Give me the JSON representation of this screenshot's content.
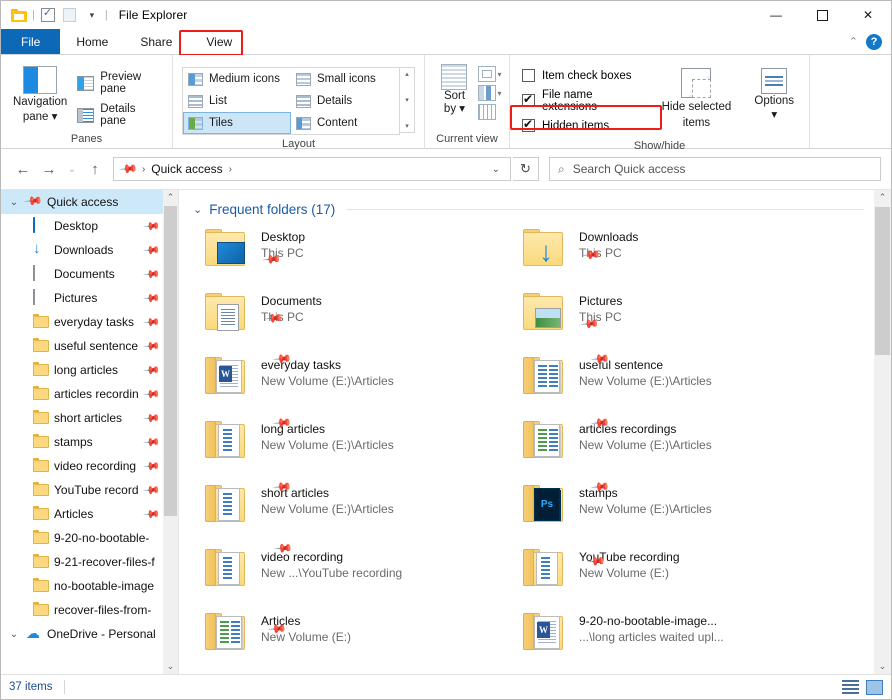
{
  "window": {
    "title": "File Explorer",
    "quick_access_toolbar": [
      {
        "name": "folder-icon",
        "label": ""
      },
      {
        "name": "properties-icon",
        "label": ""
      },
      {
        "name": "new-folder-icon",
        "label": ""
      },
      {
        "name": "customize-caret-icon",
        "label": "⌄"
      }
    ],
    "controls": {
      "minimize": "—",
      "maximize": "☐",
      "close": "✕"
    },
    "ribbon_collapse": "⌃",
    "help": "?"
  },
  "tabs": [
    {
      "label": "File",
      "active": false,
      "style": "file"
    },
    {
      "label": "Home",
      "active": false,
      "style": "normal"
    },
    {
      "label": "Share",
      "active": false,
      "style": "normal"
    },
    {
      "label": "View",
      "active": true,
      "style": "normal",
      "highlighted": true
    }
  ],
  "ribbon": {
    "groups": [
      {
        "name": "panes",
        "label": "Panes",
        "big_button": {
          "label_line1": "Navigation",
          "label_line2": "pane ▾"
        },
        "small_buttons": [
          {
            "label": "Preview pane",
            "icon": "preview-pane-icon"
          },
          {
            "label": "Details pane",
            "icon": "details-pane-icon"
          }
        ]
      },
      {
        "name": "layout",
        "label": "Layout",
        "items": [
          {
            "label": "Medium icons",
            "selected": false
          },
          {
            "label": "Small icons",
            "selected": false
          },
          {
            "label": "List",
            "selected": false
          },
          {
            "label": "Details",
            "selected": false
          },
          {
            "label": "Tiles",
            "selected": true
          },
          {
            "label": "Content",
            "selected": false
          }
        ],
        "spinner": {
          "up": "▴",
          "down": "▾",
          "more": "▾"
        }
      },
      {
        "name": "current-view",
        "label": "Current view",
        "sort_by": {
          "line1": "Sort",
          "line2": "by ▾"
        },
        "small_icons": [
          "group-by-icon",
          "add-columns-icon",
          "size-all-columns-icon"
        ]
      },
      {
        "name": "show-hide",
        "label": "Show/hide",
        "checkboxes": [
          {
            "label": "Item check boxes",
            "checked": false,
            "highlighted": false
          },
          {
            "label": "File name extensions",
            "checked": true,
            "highlighted": false
          },
          {
            "label": "Hidden items",
            "checked": true,
            "highlighted": true
          }
        ],
        "hide_selected": {
          "line1": "Hide selected",
          "line2": "items"
        },
        "options": {
          "line1": "Options",
          "line2": "▾"
        }
      }
    ]
  },
  "address_bar": {
    "back": "←",
    "forward": "→",
    "recent": "⌄",
    "up": "↑",
    "breadcrumb": [
      {
        "label": "Quick access",
        "icon": "pin-icon"
      }
    ],
    "separator": "›",
    "dropdown": "⌄",
    "refresh": "↻",
    "search_placeholder": "Search Quick access",
    "search_icon": "search-icon"
  },
  "sidebar": {
    "items": [
      {
        "label": "Quick access",
        "icon": "pin-icon",
        "level": "root",
        "chevron": "⌄",
        "selected": true,
        "pinned": false
      },
      {
        "label": "Desktop",
        "icon": "desktop-icon",
        "level": "child",
        "pinned": true
      },
      {
        "label": "Downloads",
        "icon": "downloads-icon",
        "level": "child",
        "pinned": true
      },
      {
        "label": "Documents",
        "icon": "documents-icon",
        "level": "child",
        "pinned": true
      },
      {
        "label": "Pictures",
        "icon": "pictures-icon",
        "level": "child",
        "pinned": true
      },
      {
        "label": "everyday tasks",
        "icon": "folder-icon",
        "level": "child",
        "pinned": true
      },
      {
        "label": "useful sentence",
        "icon": "folder-icon",
        "level": "child",
        "pinned": true
      },
      {
        "label": "long articles",
        "icon": "folder-icon",
        "level": "child",
        "pinned": true
      },
      {
        "label": "articles recordin",
        "icon": "folder-icon",
        "level": "child",
        "pinned": true
      },
      {
        "label": "short articles",
        "icon": "folder-icon",
        "level": "child",
        "pinned": true
      },
      {
        "label": "stamps",
        "icon": "folder-icon",
        "level": "child",
        "pinned": true
      },
      {
        "label": "video recording",
        "icon": "folder-icon",
        "level": "child",
        "pinned": true
      },
      {
        "label": "YouTube record",
        "icon": "folder-icon",
        "level": "child",
        "pinned": true
      },
      {
        "label": "Articles",
        "icon": "folder-icon",
        "level": "child",
        "pinned": true
      },
      {
        "label": "9-20-no-bootable-",
        "icon": "folder-icon",
        "level": "child",
        "pinned": false
      },
      {
        "label": "9-21-recover-files-f",
        "icon": "folder-icon",
        "level": "child",
        "pinned": false
      },
      {
        "label": "no-bootable-image",
        "icon": "folder-icon",
        "level": "child",
        "pinned": false
      },
      {
        "label": "recover-files-from-",
        "icon": "folder-icon",
        "level": "child",
        "pinned": false
      },
      {
        "label": "OneDrive - Personal",
        "icon": "cloud-icon",
        "level": "root",
        "chevron": "⌄",
        "selected": false,
        "pinned": false
      }
    ],
    "scrollbar": {
      "up": "⌃",
      "down": "⌄"
    }
  },
  "content": {
    "section": {
      "chevron": "⌄",
      "title": "Frequent folders (17)"
    },
    "tiles": [
      {
        "name": "Desktop",
        "sub": "This PC",
        "icon": "folder-desktop-icon",
        "pinned": true
      },
      {
        "name": "Downloads",
        "sub": "This PC",
        "icon": "folder-downloads-icon",
        "pinned": true
      },
      {
        "name": "Documents",
        "sub": "This PC",
        "icon": "folder-documents-icon",
        "pinned": true
      },
      {
        "name": "Pictures",
        "sub": "This PC",
        "icon": "folder-pictures-icon",
        "pinned": true
      },
      {
        "name": "everyday tasks",
        "sub": "New Volume (E:)\\Articles",
        "icon": "folder-word-icon",
        "pinned": true
      },
      {
        "name": "useful sentence",
        "sub": "New Volume (E:)\\Articles",
        "icon": "folder-docs-icon",
        "pinned": true
      },
      {
        "name": "long articles",
        "sub": "New Volume (E:)\\Articles",
        "icon": "folder-lines-icon",
        "pinned": true
      },
      {
        "name": "articles recordings",
        "sub": "New Volume (E:)\\Articles",
        "icon": "folder-green-icon",
        "pinned": true
      },
      {
        "name": "short articles",
        "sub": "New Volume (E:)\\Articles",
        "icon": "folder-lines-icon",
        "pinned": true
      },
      {
        "name": "stamps",
        "sub": "New Volume (E:)\\Articles",
        "icon": "folder-ps-icon",
        "pinned": true
      },
      {
        "name": "video recording",
        "sub": "New ...\\YouTube recording",
        "icon": "folder-lines-icon",
        "pinned": true
      },
      {
        "name": "YouTube recording",
        "sub": "New Volume (E:)",
        "icon": "folder-lines-icon",
        "pinned": true
      },
      {
        "name": "Articles",
        "sub": "New Volume (E:)",
        "icon": "folder-green-icon",
        "pinned": true
      },
      {
        "name": "9-20-no-bootable-image...",
        "sub": "...\\long articles waited upl...",
        "icon": "folder-word-icon",
        "pinned": false
      }
    ],
    "scrollbar": {
      "up": "⌃",
      "down": "⌄"
    }
  },
  "status_bar": {
    "item_count": "37 items",
    "view_buttons": [
      {
        "name": "details-view-button",
        "label": ""
      },
      {
        "name": "large-icons-view-button",
        "label": ""
      }
    ]
  },
  "colors": {
    "accent": "#0d68b8",
    "highlight_red": "#f01c1c",
    "selection_blue": "#cde8f9",
    "link_blue": "#1b5aa8"
  }
}
